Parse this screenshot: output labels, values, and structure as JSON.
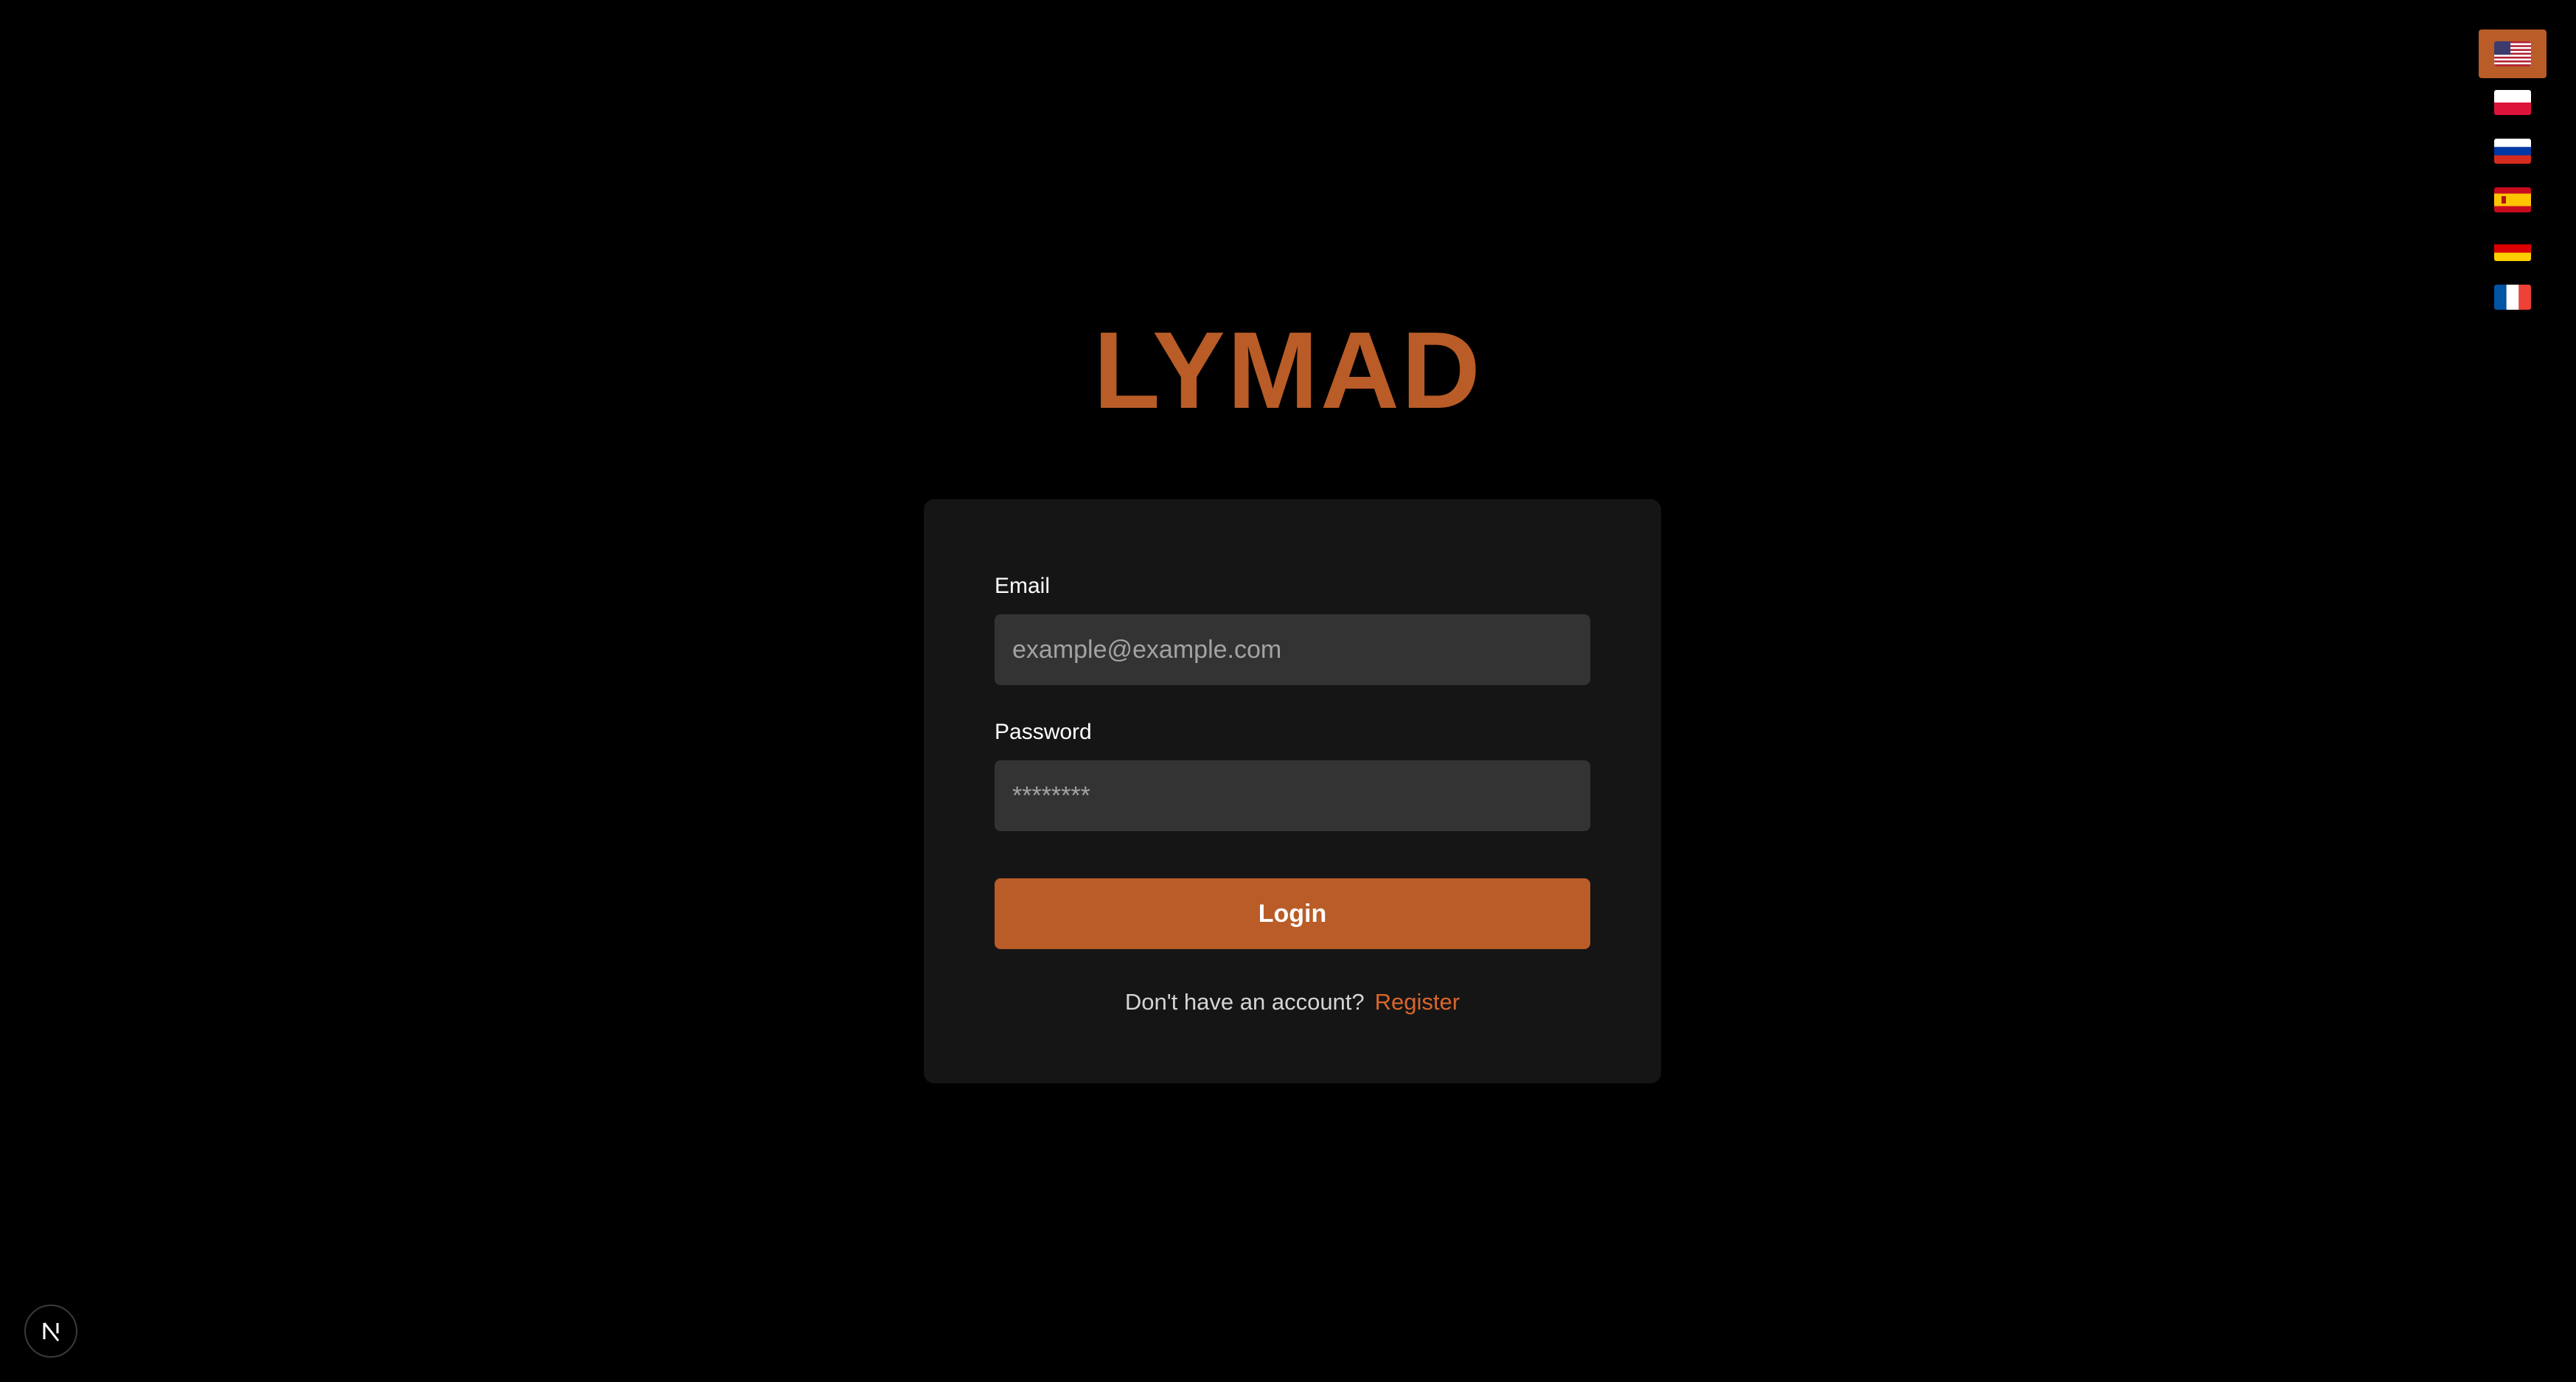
{
  "languages": {
    "items": [
      {
        "code": "en-US",
        "icon": "us-flag-icon",
        "active": true
      },
      {
        "code": "pl",
        "icon": "poland-flag-icon",
        "active": false
      },
      {
        "code": "ru",
        "icon": "russia-flag-icon",
        "active": false
      },
      {
        "code": "es",
        "icon": "spain-flag-icon",
        "active": false
      },
      {
        "code": "de",
        "icon": "germany-flag-icon",
        "active": false
      },
      {
        "code": "fr",
        "icon": "france-flag-icon",
        "active": false
      }
    ],
    "active_color": "#b95c27"
  },
  "brand": {
    "logo_text": "LYMAD",
    "accent_color": "#b95c27"
  },
  "form": {
    "email_label": "Email",
    "email_placeholder": "example@example.com",
    "email_value": "",
    "password_label": "Password",
    "password_placeholder": "********",
    "password_value": "",
    "login_label": "Login",
    "register_prompt": "Don't have an account?",
    "register_link": "Register"
  },
  "dev_indicator": {
    "icon": "nextjs-logo-icon",
    "letter": "N"
  },
  "colors": {
    "background": "#000000",
    "card": "#151515",
    "input": "#333333",
    "link": "#d9662b"
  }
}
